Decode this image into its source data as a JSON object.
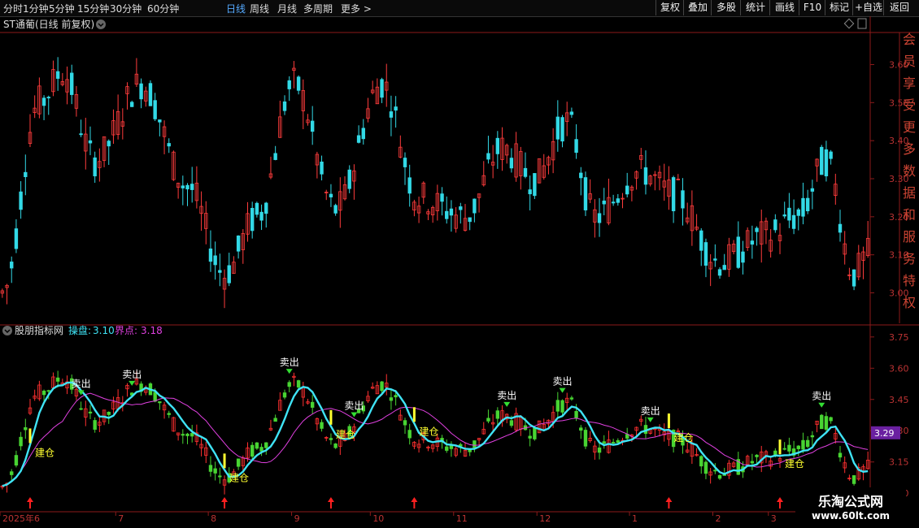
{
  "toolbar": {
    "periods": [
      "分时",
      "1分钟",
      "5分钟",
      "15分钟",
      "30分钟",
      "60分钟",
      "日线",
      "周线",
      "月线",
      "多周期",
      "更多 >"
    ],
    "active_period": "日线",
    "buttons": [
      "复权",
      "叠加",
      "多股",
      "统计",
      "画线",
      "F10",
      "标记",
      "+自选",
      "返回"
    ]
  },
  "main_panel": {
    "title": "ST通葡(日线 前复权)",
    "y_ticks": [
      3.0,
      3.1,
      3.2,
      3.3,
      3.4,
      3.5,
      3.6
    ],
    "y_range": [
      2.92,
      3.68
    ],
    "side_text": [
      "会",
      "员",
      "享",
      "受",
      "更",
      "多",
      "数",
      "据",
      "和",
      "服",
      "务",
      "特",
      "权"
    ]
  },
  "indicator_panel": {
    "name": "股朋指标网",
    "caopan_label": "操盘:",
    "caopan_value": "3.10",
    "jiedian_label": "界点:",
    "jiedian_value": "3.18",
    "y_ticks": [
      3.0,
      3.15,
      3.3,
      3.45,
      3.6,
      3.75
    ],
    "y_range": [
      2.95,
      3.8
    ],
    "current_value": "3.29",
    "sell_label": "卖出",
    "build_label": "建仓"
  },
  "x_axis": {
    "labels": [
      {
        "t": "2025年6",
        "i": 0
      },
      {
        "t": "7",
        "i": 25
      },
      {
        "t": "8",
        "i": 45
      },
      {
        "t": "9",
        "i": 63
      },
      {
        "t": "10",
        "i": 80
      },
      {
        "t": "11",
        "i": 98
      },
      {
        "t": "12",
        "i": 116
      },
      {
        "t": "1",
        "i": 136
      },
      {
        "t": "2",
        "i": 154
      },
      {
        "t": "3",
        "i": 166
      }
    ]
  },
  "watermark": {
    "title": "乐淘公式网",
    "url": "www.60lt.com"
  },
  "colors": {
    "up": "#ff3c3c",
    "down": "#32d9e6",
    "caopan": "#3fe3f5",
    "jiedian": "#e040e0",
    "ind_up": "#ff3030",
    "ind_down": "#48d432",
    "sell_arrow": "#33dd33",
    "buy_arrow": "#ff2020",
    "yellow": "#ffff30"
  },
  "chart_data": {
    "type": "candlestick",
    "count": 188,
    "sell_signals": [
      17,
      28,
      62,
      76,
      109,
      121,
      140,
      177
    ],
    "build_signals": [
      6,
      48,
      71,
      89,
      144,
      168
    ],
    "close_start": 3.0,
    "close_end": 3.1
  }
}
